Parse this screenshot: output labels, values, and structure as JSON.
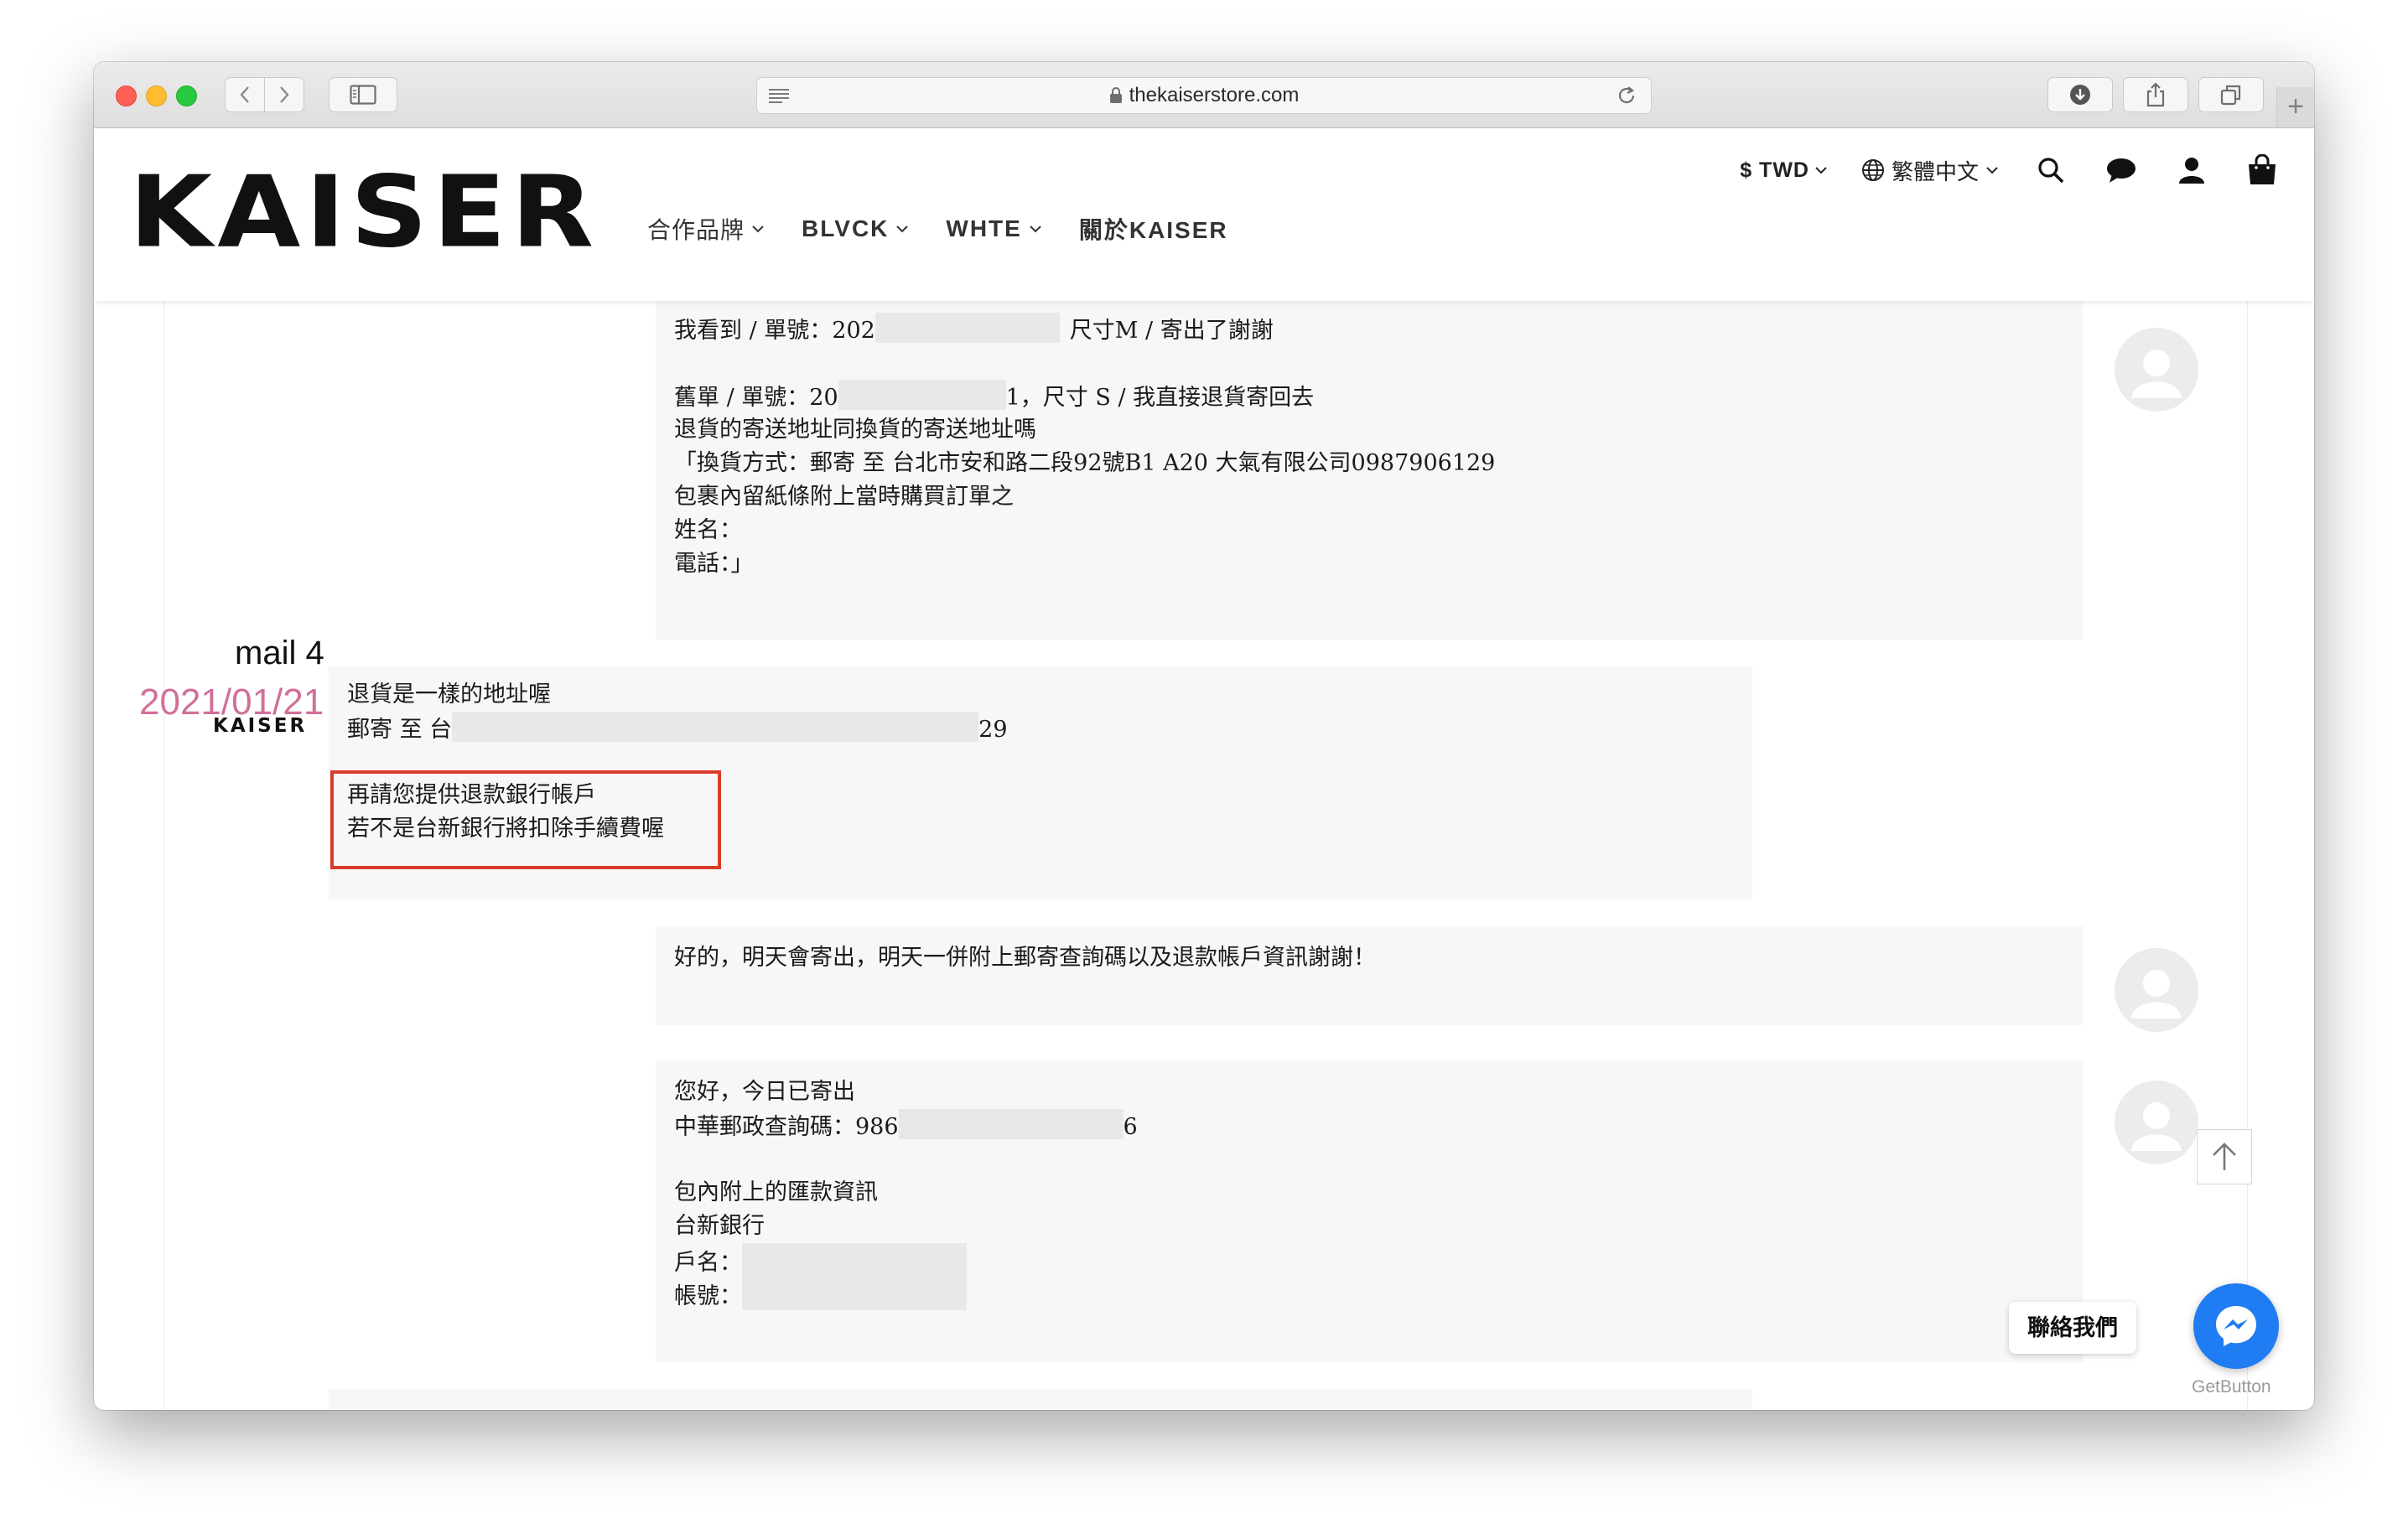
{
  "browser": {
    "url": "thekaiserstore.com"
  },
  "site": {
    "logo": "KAISER",
    "nav": [
      {
        "label": "合作品牌"
      },
      {
        "label": "BLVCK"
      },
      {
        "label": "WHTE"
      },
      {
        "label": "關於KAISER"
      }
    ],
    "currency": "$ TWD",
    "language": "繁體中文"
  },
  "thread": {
    "mail_label": "mail 4",
    "mail_date": "2021/01/21",
    "sender_name": "KAISER",
    "message1": {
      "l1_prefix": "我看到 / 單號：202",
      "l1_suffix": "尺寸M / 寄出了謝謝",
      "l2_prefix": "舊單 / 單號：20",
      "l2_suffix": "1，尺寸 S / 我直接退貨寄回去",
      "l3": "退貨的寄送地址同換貨的寄送地址嗎",
      "l4": "「換貨方式：郵寄 至 台北市安和路二段92號B1 A20 大氣有限公司0987906129",
      "l5": "包裹內留紙條附上當時購買訂單之",
      "l6": "姓名：",
      "l7": "電話：」"
    },
    "message2": {
      "l1": "退貨是一樣的地址喔",
      "l2_prefix": "郵寄 至 台",
      "l2_suffix": "29",
      "l3": "再請您提供退款銀行帳戶",
      "l4": "若不是台新銀行將扣除手續費喔"
    },
    "message3": {
      "l1": "好的，明天會寄出，明天一併附上郵寄查詢碼以及退款帳戶資訊謝謝！"
    },
    "message4": {
      "l1": "您好，今日已寄出",
      "l2_prefix": "中華郵政查詢碼：986",
      "l2_suffix": "6",
      "l3": "包內附上的匯款資訊",
      "l4": "台新銀行",
      "l5": "戶名：",
      "l6": "帳號："
    }
  },
  "widgets": {
    "contact_label": "聯絡我們",
    "getbutton": "GetButton"
  },
  "colors": {
    "highlight_border": "#d93b2b",
    "date_pink": "#d0709a",
    "messenger_blue": "#1f7cf2"
  }
}
